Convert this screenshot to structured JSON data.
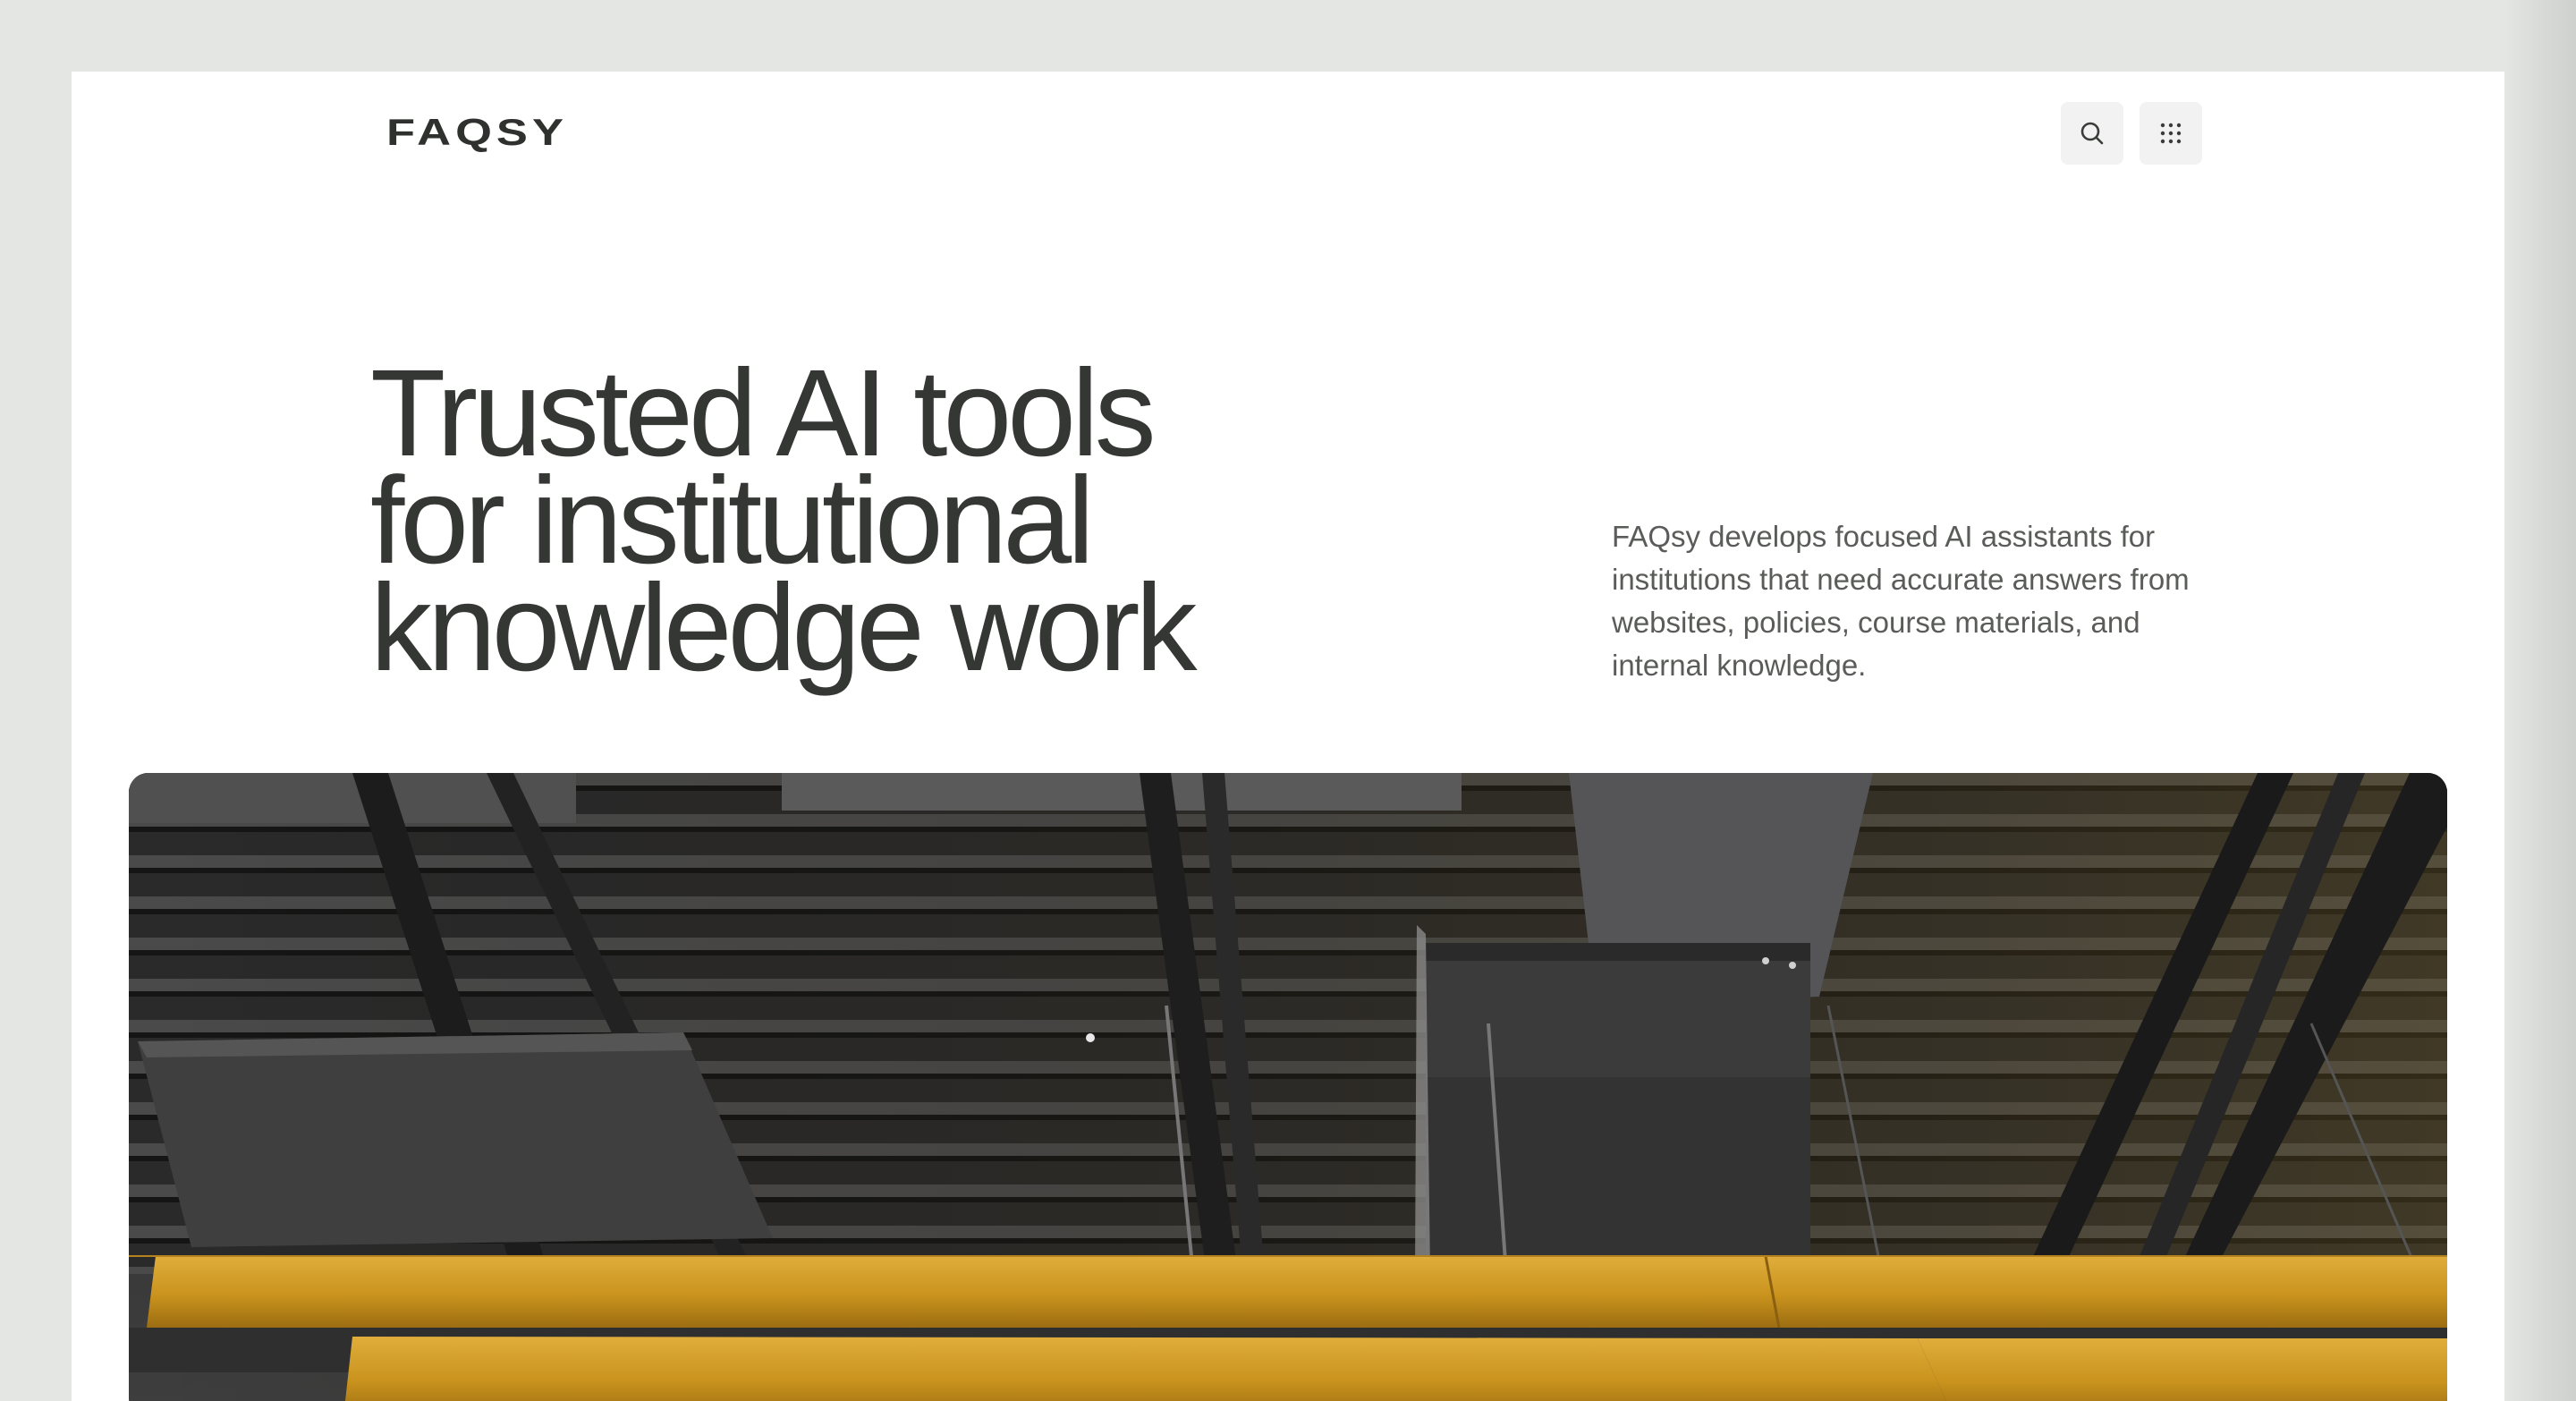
{
  "header": {
    "logo_text": "FAQSY",
    "search_button": {
      "icon": "search-icon"
    },
    "menu_button": {
      "icon": "grid-dots-icon"
    }
  },
  "hero": {
    "title_lines": [
      "Trusted AI tools",
      "for institutional",
      "knowledge work"
    ],
    "description": "FAQsy develops focused AI assistants for institutions that need accurate answers from websites, policies, course materials, and internal knowledge."
  },
  "image": {
    "subject": "industrial-ceiling-photo",
    "colors": {
      "steel": "#3b3b3b",
      "dark": "#1e1e1e",
      "wood": "#c9951e",
      "wood_light": "#dca93a"
    }
  }
}
